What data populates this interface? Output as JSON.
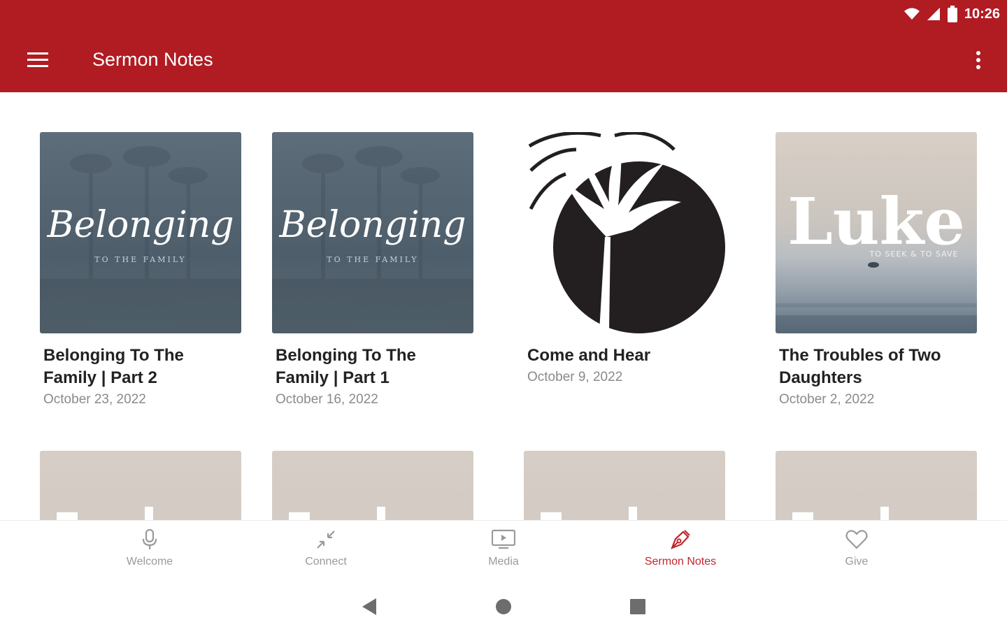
{
  "status": {
    "time": "10:26"
  },
  "appbar": {
    "title": "Sermon Notes"
  },
  "sermons": [
    {
      "title": "Belonging To The Family | Part 2",
      "date": "October 23, 2022",
      "art_text": "Belonging",
      "art_sub": "TO THE FAMILY"
    },
    {
      "title": "Belonging To The Family | Part 1",
      "date": "October 16, 2022",
      "art_text": "Belonging",
      "art_sub": "TO THE FAMILY"
    },
    {
      "title": "Come and Hear",
      "date": "October 9, 2022"
    },
    {
      "title": "The Troubles of Two Daughters",
      "date": "October 2, 2022",
      "art_text": "Luke",
      "art_sub": "TO SEEK & TO SAVE"
    }
  ],
  "nav": [
    {
      "label": "Welcome",
      "icon": "microphone-icon"
    },
    {
      "label": "Connect",
      "icon": "connect-arrows-icon"
    },
    {
      "label": "Media",
      "icon": "tv-play-icon"
    },
    {
      "label": "Sermon Notes",
      "icon": "pen-icon",
      "active": true
    },
    {
      "label": "Give",
      "icon": "heart-icon"
    }
  ],
  "colors": {
    "brand": "#b01c22",
    "active": "#c0262d",
    "muted": "#9a9a9a"
  }
}
